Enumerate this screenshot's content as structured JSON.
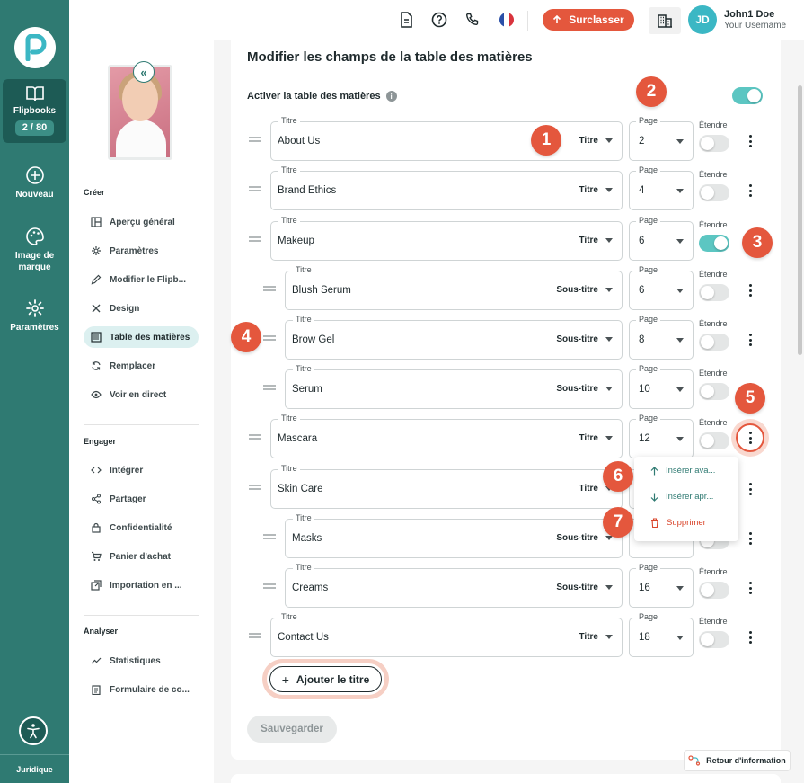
{
  "nav_rail": {
    "items": [
      {
        "label": "Flipbooks",
        "icon": "book-open-icon",
        "badge": "2 / 80"
      },
      {
        "label": "Nouveau",
        "icon": "plus-circle-icon"
      },
      {
        "label": "Image de marque",
        "icon": "palette-icon"
      },
      {
        "label": "Paramètres",
        "icon": "gear-icon"
      }
    ],
    "legal": "Juridique"
  },
  "topbar": {
    "upgrade": "Surclasser",
    "avatar_initials": "JD",
    "user_name": "John1 Doe",
    "user_sub": "Your Username"
  },
  "sidebar": {
    "sections": [
      {
        "title": "Créer",
        "items": [
          "Aperçu général",
          "Paramètres",
          "Modifier le Flipb...",
          "Design",
          "Table des matières",
          "Remplacer",
          "Voir en direct"
        ]
      },
      {
        "title": "Engager",
        "items": [
          "Intégrer",
          "Partager",
          "Confidentialité",
          "Panier d'achat",
          "Importation en ..."
        ]
      },
      {
        "title": "Analyser",
        "items": [
          "Statistiques",
          "Formulaire de co..."
        ]
      }
    ],
    "active_item": "Table des matières"
  },
  "editor": {
    "title": "Modifier les champs de la table des matières",
    "enable_label": "Activer la table des matières",
    "enable_on": true,
    "field_title_label": "Titre",
    "field_page_label": "Page",
    "expand_label": "Étendre",
    "rows": [
      {
        "title": "About Us",
        "type": "Titre",
        "page": "2",
        "expand": false
      },
      {
        "title": "Brand Ethics",
        "type": "Titre",
        "page": "4",
        "expand": false
      },
      {
        "title": "Makeup",
        "type": "Titre",
        "page": "6",
        "expand": true
      },
      {
        "title": "Blush Serum",
        "type": "Sous-titre",
        "page": "6",
        "expand": false
      },
      {
        "title": "Brow Gel",
        "type": "Sous-titre",
        "page": "8",
        "expand": false
      },
      {
        "title": "Serum",
        "type": "Sous-titre",
        "page": "10",
        "expand": false
      },
      {
        "title": "Mascara",
        "type": "Titre",
        "page": "12",
        "expand": false
      },
      {
        "title": "Skin Care",
        "type": "Titre",
        "page": "",
        "expand": false
      },
      {
        "title": "Masks",
        "type": "Sous-titre",
        "page": "",
        "expand": false
      },
      {
        "title": "Creams",
        "type": "Sous-titre",
        "page": "16",
        "expand": false
      },
      {
        "title": "Contact Us",
        "type": "Titre",
        "page": "18",
        "expand": false
      }
    ],
    "context_menu": {
      "insert_before": "Insérer ava...",
      "insert_after": "Insérer apr...",
      "delete": "Supprimer"
    },
    "add_title": "Ajouter le titre",
    "save": "Sauvegarder"
  },
  "step_markers": [
    "1",
    "2",
    "3",
    "4",
    "5",
    "6",
    "7"
  ],
  "feedback": "Retour d'information",
  "colors": {
    "rail": "#2f7a72",
    "accent": "#e4573d",
    "toggle_on": "#5cc6c2"
  }
}
